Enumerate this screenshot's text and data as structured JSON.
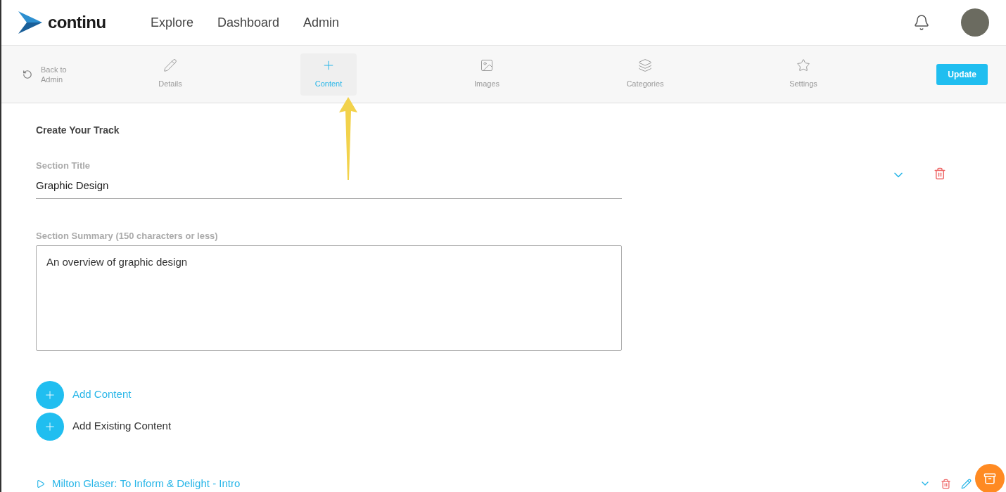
{
  "header": {
    "logo": "continu",
    "nav": [
      "Explore",
      "Dashboard",
      "Admin"
    ]
  },
  "toolbar": {
    "back": "Back to\nAdmin",
    "tabs": [
      {
        "label": "Details",
        "selected": false
      },
      {
        "label": "Content",
        "selected": true
      },
      {
        "label": "Images",
        "selected": false
      },
      {
        "label": "Categories",
        "selected": false
      },
      {
        "label": "Settings",
        "selected": false
      }
    ],
    "update": "Update"
  },
  "form": {
    "heading": "Create Your Track",
    "section_title": {
      "label": "Section Title",
      "value": "Graphic Design"
    },
    "summary": {
      "label": "Section Summary (150 characters or less)",
      "value": "An overview of graphic design"
    },
    "actions": [
      "Add Content",
      "Add Existing Content"
    ]
  },
  "content_items": [
    {
      "title": "Milton Glaser: To Inform & Delight - Intro"
    }
  ]
}
